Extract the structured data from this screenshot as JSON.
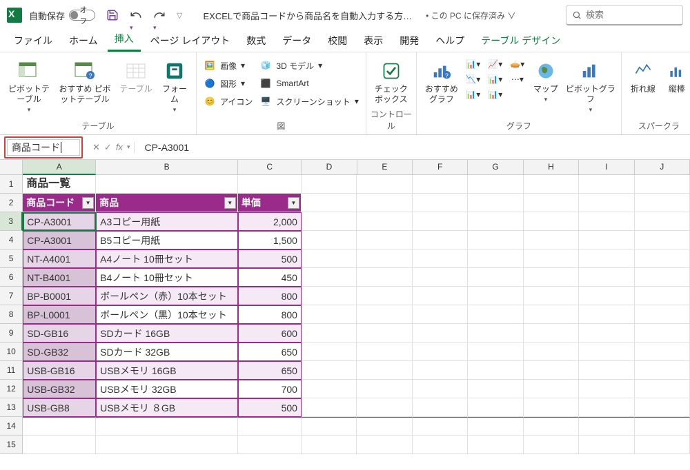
{
  "titlebar": {
    "autosave_label": "自動保存",
    "autosave_state": "オフ",
    "doc_title": "EXCELで商品コードから商品名を自動入力する方…",
    "save_status": "• この PC に保存済み ∨",
    "search_placeholder": "検索"
  },
  "tabs": [
    "ファイル",
    "ホーム",
    "挿入",
    "ページ レイアウト",
    "数式",
    "データ",
    "校閲",
    "表示",
    "開発",
    "ヘルプ",
    "テーブル デザイン"
  ],
  "active_tab_index": 2,
  "ribbon": {
    "tables": {
      "pivot": "ピボットテ\nーブル",
      "rec_pivot": "おすすめ\nピボットテーブル",
      "table": "テーブル",
      "forms": "フォー\nム",
      "group": "テーブル"
    },
    "illustrations": {
      "pictures": "画像",
      "shapes": "図形",
      "icons": "アイコン",
      "model3d": "3D モデル",
      "smartart": "SmartArt",
      "screenshot": "スクリーンショット",
      "group": "図"
    },
    "controls": {
      "checkbox": "チェック\nボックス",
      "group": "コントロール"
    },
    "charts": {
      "rec": "おすすめ\nグラフ",
      "map": "マップ",
      "pivot": "ピボットグラフ",
      "group": "グラフ"
    },
    "sparklines": {
      "line": "折れ線",
      "column": "縦棒",
      "group": "スパークラ"
    }
  },
  "namebox": "商品コード",
  "formula": "CP-A3001",
  "columns": [
    "A",
    "B",
    "C",
    "D",
    "E",
    "F",
    "G",
    "H",
    "I",
    "J"
  ],
  "sheet_title": "商品一覧",
  "headers": [
    "商品コード",
    "商品",
    "単価"
  ],
  "rows": [
    {
      "code": "CP-A3001",
      "name": "A3コピー用紙",
      "price": "2,000"
    },
    {
      "code": "CP-A3001",
      "name": "B5コピー用紙",
      "price": "1,500"
    },
    {
      "code": "NT-A4001",
      "name": "A4ノート 10冊セット",
      "price": "500"
    },
    {
      "code": "NT-B4001",
      "name": "B4ノート 10冊セット",
      "price": "450"
    },
    {
      "code": "BP-B0001",
      "name": "ボールペン（赤）10本セット",
      "price": "800"
    },
    {
      "code": "BP-L0001",
      "name": "ボールペン（黒）10本セット",
      "price": "800"
    },
    {
      "code": "SD-GB16",
      "name": "SDカード 16GB",
      "price": "600"
    },
    {
      "code": "SD-GB32",
      "name": "SDカード 32GB",
      "price": "650"
    },
    {
      "code": "USB-GB16",
      "name": "USBメモリ 16GB",
      "price": "650"
    },
    {
      "code": "USB-GB32",
      "name": "USBメモリ 32GB",
      "price": "700"
    },
    {
      "code": "USB-GB8",
      "name": "USBメモリ ８GB",
      "price": "500"
    }
  ]
}
